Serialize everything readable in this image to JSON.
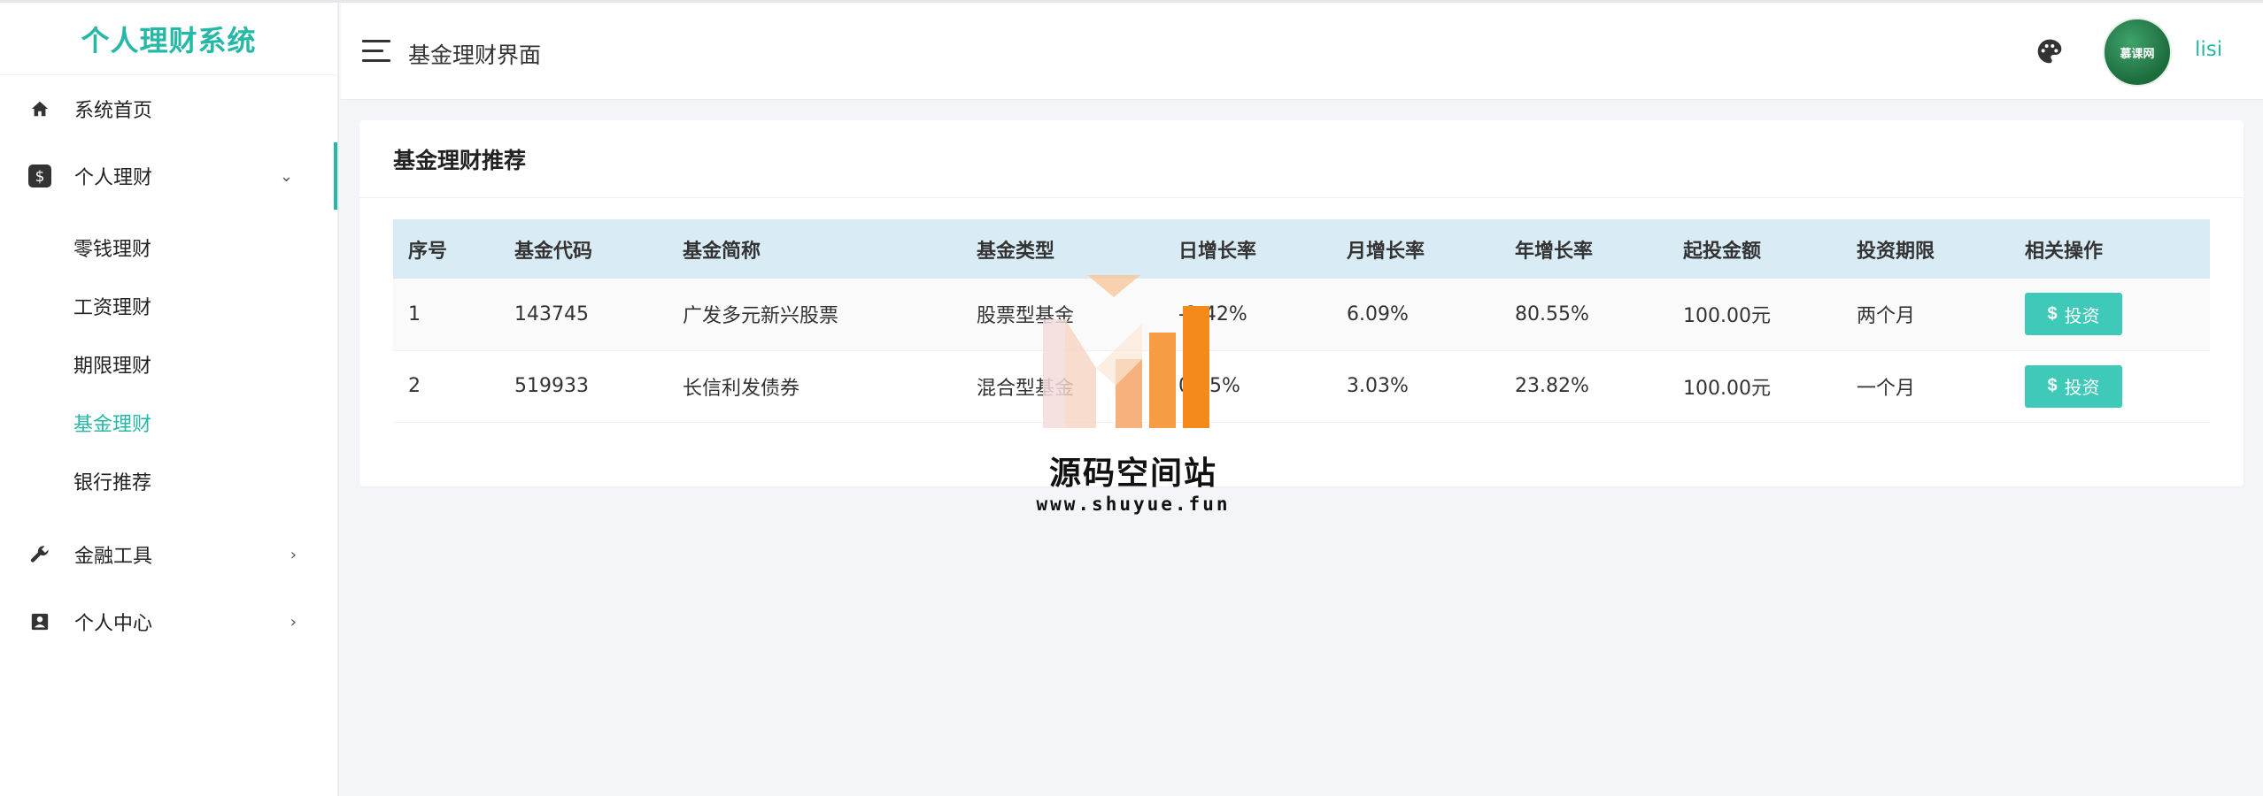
{
  "brand": {
    "title": "个人理财系统"
  },
  "sidebar": {
    "items": [
      {
        "label": "系统首页",
        "icon": "home-icon"
      },
      {
        "label": "个人理财",
        "icon": "dollar-icon",
        "open": true,
        "children": [
          {
            "label": "零钱理财"
          },
          {
            "label": "工资理财"
          },
          {
            "label": "期限理财"
          },
          {
            "label": "基金理财",
            "active": true
          },
          {
            "label": "银行推荐"
          }
        ]
      },
      {
        "label": "金融工具",
        "icon": "wrench-icon"
      },
      {
        "label": "个人中心",
        "icon": "user-card-icon"
      }
    ]
  },
  "header": {
    "title": "基金理财界面",
    "username": "lisi",
    "avatar_text": "慕课网"
  },
  "card": {
    "title": "基金理财推荐",
    "columns": [
      "序号",
      "基金代码",
      "基金简称",
      "基金类型",
      "日增长率",
      "月增长率",
      "年增长率",
      "起投金额",
      "投资期限",
      "相关操作"
    ],
    "rows": [
      {
        "no": "1",
        "code": "143745",
        "name": "广发多元新兴股票",
        "type": "股票型基金",
        "daily": "-2.42%",
        "monthly": "6.09%",
        "yearly": "80.55%",
        "min": "100.00元",
        "term": "两个月",
        "action": "投资"
      },
      {
        "no": "2",
        "code": "519933",
        "name": "长信利发债券",
        "type": "混合型基金",
        "daily": "0.05%",
        "monthly": "3.03%",
        "yearly": "23.82%",
        "min": "100.00元",
        "term": "一个月",
        "action": "投资"
      }
    ]
  },
  "watermark": {
    "title": "源码空间站",
    "url": "www.shuyue.fun"
  },
  "colors": {
    "accent": "#26b8a6",
    "button": "#3ec9b8",
    "table_header": "#d9ecf5"
  }
}
